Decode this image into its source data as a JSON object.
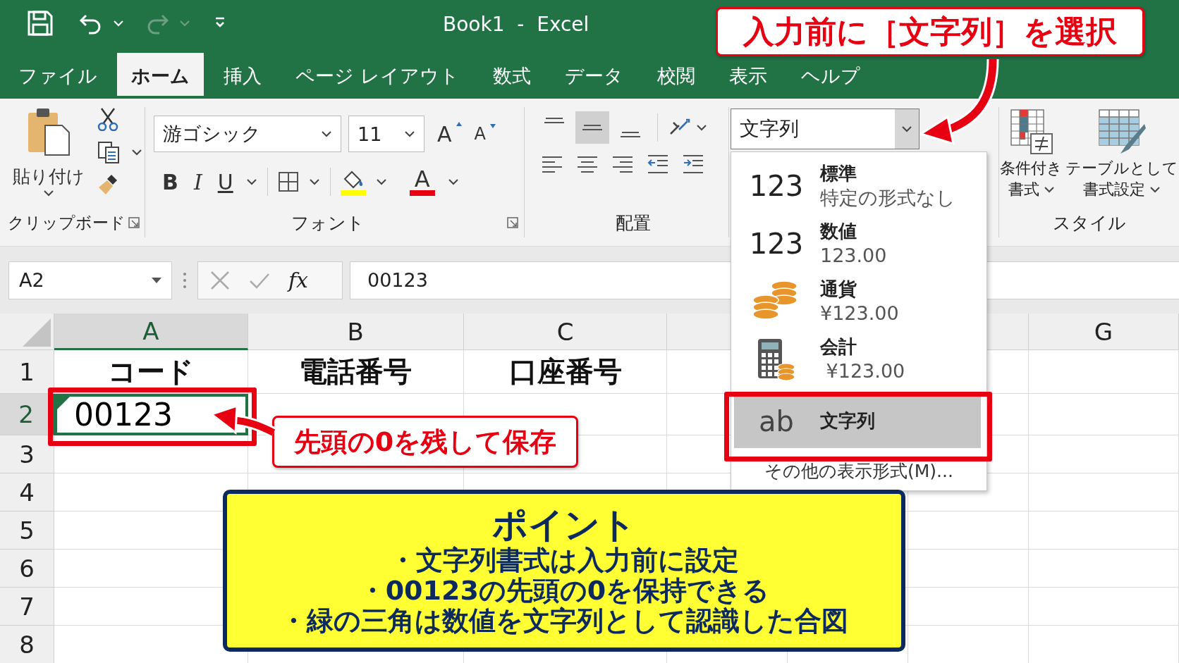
{
  "title_bar": {
    "title": "Book1  -  Excel"
  },
  "tabs": [
    {
      "label": "ファイル",
      "selected": false
    },
    {
      "label": "ホーム",
      "selected": true
    },
    {
      "label": "挿入",
      "selected": false
    },
    {
      "label": "ページ レイアウト",
      "selected": false
    },
    {
      "label": "数式",
      "selected": false
    },
    {
      "label": "データ",
      "selected": false
    },
    {
      "label": "校閲",
      "selected": false
    },
    {
      "label": "表示",
      "selected": false
    },
    {
      "label": "ヘルプ",
      "selected": false
    }
  ],
  "ribbon": {
    "clipboard": {
      "paste_label": "貼り付け",
      "group_label": "クリップボード"
    },
    "font": {
      "font_name": "游ゴシック",
      "font_size": "11",
      "grow": "A",
      "shrink": "A",
      "bold": "B",
      "italic": "I",
      "underline": "U",
      "font_color": "A",
      "group_label": "フォント"
    },
    "alignment": {
      "vertical": [
        {
          "selected": false
        },
        {
          "selected": true
        },
        {
          "selected": false
        }
      ],
      "group_label": "配置"
    },
    "number": {
      "format_value": "文字列"
    },
    "styles": {
      "buttons": [
        {
          "label_lines": [
            "条件付き",
            "書式"
          ]
        },
        {
          "label_lines": [
            "テーブルとして",
            "書式設定"
          ]
        }
      ],
      "group_label": "スタイル"
    }
  },
  "formula_bar": {
    "name_box": "A2",
    "fx": "fx",
    "value": "00123"
  },
  "sheet": {
    "columns": [
      {
        "label": "A",
        "selected": true
      },
      {
        "label": "B",
        "selected": false
      },
      {
        "label": "C",
        "selected": false
      },
      {
        "label": "G",
        "selected": false
      }
    ],
    "rows": [
      {
        "label": "1",
        "selected": false,
        "cells": [
          {
            "text": "コード"
          },
          {
            "text": "電話番号"
          },
          {
            "text": "口座番号"
          }
        ]
      },
      {
        "label": "2",
        "selected": true,
        "cells": [
          {
            "text": "00123",
            "active": true,
            "error_indicator": true,
            "highlighted": true
          }
        ]
      },
      {
        "label": "3",
        "selected": false
      },
      {
        "label": "4",
        "selected": false
      },
      {
        "label": "5",
        "selected": false
      },
      {
        "label": "6",
        "selected": false
      },
      {
        "label": "7",
        "selected": false
      },
      {
        "label": "8",
        "selected": false
      }
    ]
  },
  "format_menu": {
    "items": [
      {
        "kind": "digits",
        "glyph": "123",
        "title": "標準",
        "sample": "特定の形式なし",
        "selected": false,
        "highlighted": false
      },
      {
        "kind": "digits",
        "glyph": "123",
        "title": "数値",
        "sample": "123.00",
        "selected": false,
        "highlighted": false
      },
      {
        "kind": "coins",
        "title": "通貨",
        "sample": "¥123.00",
        "selected": false,
        "highlighted": false
      },
      {
        "kind": "calculator",
        "title": "会計",
        "sample": " ¥123.00",
        "selected": false,
        "highlighted": false
      },
      {
        "kind": "letters",
        "glyph": "ab",
        "title": "文字列",
        "selected": true,
        "highlighted": true
      }
    ],
    "more": "その他の表示形式(M)..."
  },
  "callouts": [
    {
      "text": "入力前に［文字列］を選択"
    },
    {
      "text": "先頭の0を残して保存"
    }
  ],
  "point_box": {
    "title": "ポイント",
    "bullets": [
      "・文字列書式は入力前に設定",
      "・00123の先頭の0を保持できる",
      "・緑の三角は数値を文字列として認識した合図"
    ]
  }
}
